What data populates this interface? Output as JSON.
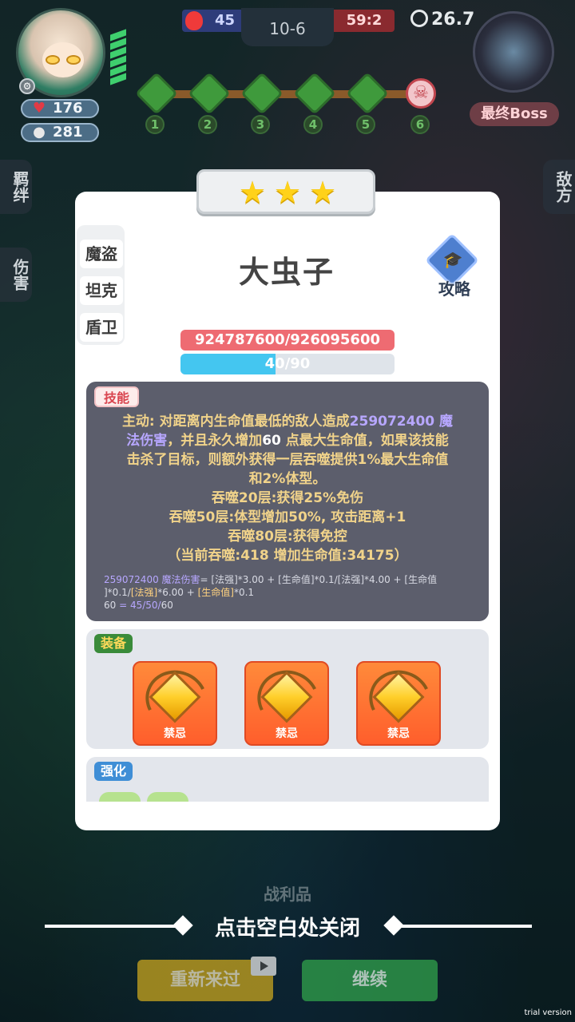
{
  "hud": {
    "hp": "176",
    "gold": "281",
    "score_blue": "45",
    "round": "10-6",
    "score_red": "59:2",
    "timer": "26.7",
    "boss_label": "最终Boss",
    "stages": [
      "1",
      "2",
      "3",
      "4",
      "5",
      "6"
    ],
    "icons": {
      "hp": "heart-icon",
      "gold": "coin-icon",
      "settings": "gear-icon",
      "timer": "clock-icon",
      "boss_node": "skull-icon"
    }
  },
  "side_tabs": {
    "bonds": "羁绊",
    "damage": "伤害",
    "enemy": "敌方"
  },
  "card": {
    "stars": 3,
    "traits": [
      "魔盗",
      "坦克",
      "盾卫"
    ],
    "name": "大虫子",
    "guide_label": "攻略",
    "hp_text": "924787600/926095600",
    "mana_text": "40/90",
    "mana_fraction": 0.444,
    "skill": {
      "tag": "技能",
      "line1_a": "主动: 对距离内生命值最低的敌人造成",
      "line1_dmg": "259072400 魔",
      "line2_dmg": "法伤害",
      "line2_b": "，并且永久增加",
      "line2_num": "60",
      "line2_c": " 点最大生命值，如果该技能",
      "line3": "击杀了目标，则额外获得一层吞噬提供1%最大生命值",
      "line4": "和2%体型。",
      "line5": "吞噬20层:获得25%免伤",
      "line6": "吞噬50层:体型增加50%, 攻击距离+1",
      "line7": "吞噬80层:获得免控",
      "line8": "（当前吞噬:418 增加生命值:34175）",
      "formula1_a": "259072400 魔法伤害",
      "formula1_b": "= [法强]*3.00 + [生命值]*0.1/[法强]*4.00 + [生命值",
      "formula2_a": "]*0.1/",
      "formula2_b": "[法强]",
      "formula2_c": "*6.00 + ",
      "formula2_d": "[生命值]",
      "formula2_e": "*0.1",
      "formula3_a": "60",
      "formula3_b": " = 45/50/",
      "formula3_c": "60"
    },
    "equipment": {
      "tag": "装备",
      "items": [
        {
          "label": "禁忌"
        },
        {
          "label": "禁忌"
        },
        {
          "label": "禁忌"
        }
      ]
    },
    "enhance": {
      "tag": "强化"
    }
  },
  "bottom": {
    "spoils_label": "战利品",
    "close_hint": "点击空白处关闭",
    "retry_label": "重新来过",
    "continue_label": "继续",
    "trial_label": "trial version"
  }
}
